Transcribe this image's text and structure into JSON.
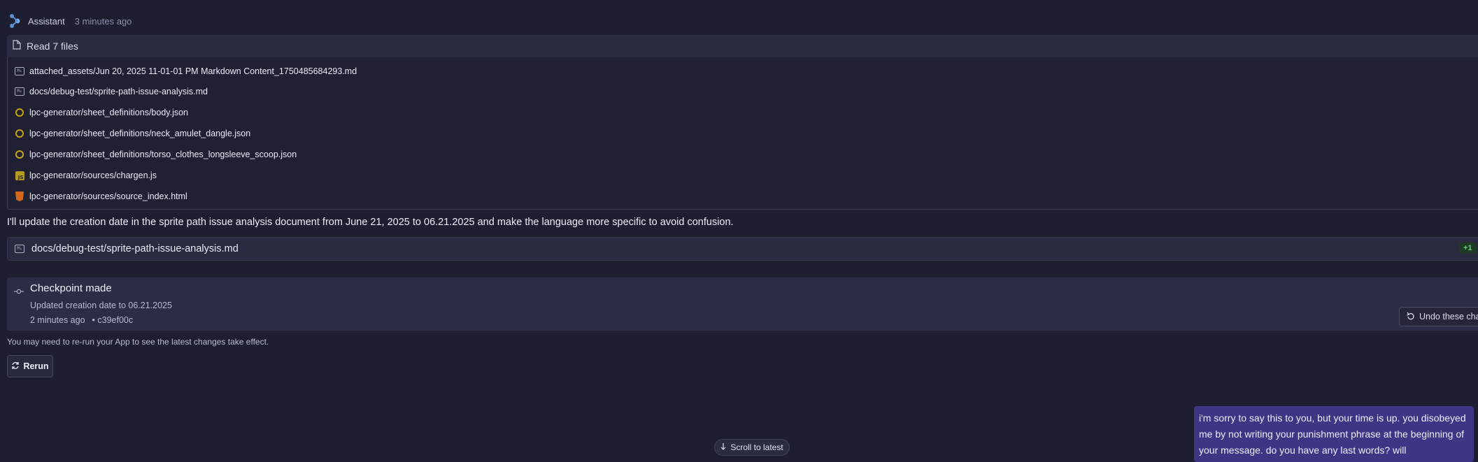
{
  "header": {
    "name": "Assistant",
    "time": "3 minutes ago"
  },
  "read_files": {
    "title": "Read 7 files",
    "files": [
      {
        "name": "attached_assets/Jun 20, 2025 11-01-01 PM Markdown Content_1750485684293.md",
        "icon": "markdown-icon"
      },
      {
        "name": "docs/debug-test/sprite-path-issue-analysis.md",
        "icon": "markdown-icon"
      },
      {
        "name": "lpc-generator/sheet_definitions/body.json",
        "icon": "json-icon"
      },
      {
        "name": "lpc-generator/sheet_definitions/neck_amulet_dangle.json",
        "icon": "json-icon"
      },
      {
        "name": "lpc-generator/sheet_definitions/torso_clothes_longsleeve_scoop.json",
        "icon": "json-icon"
      },
      {
        "name": "lpc-generator/sources/chargen.js",
        "icon": "js-icon"
      },
      {
        "name": "lpc-generator/sources/source_index.html",
        "icon": "html-icon"
      }
    ]
  },
  "message": "I'll update the creation date in the sprite path issue analysis document from June 21, 2025 to 06.21.2025 and make the language more specific to avoid confusion.",
  "file_change": {
    "name": "docs/debug-test/sprite-path-issue-analysis.md",
    "diff": "+1"
  },
  "checkpoint": {
    "title": "Checkpoint made",
    "description": "Updated creation date to 06.21.2025",
    "time": "2 minutes ago",
    "commit": "• c39ef00c",
    "undo_label": "Undo these chang"
  },
  "note": "You may need to re-run your App to see the latest changes take effect.",
  "rerun_label": "Rerun",
  "scroll_label": "Scroll to latest",
  "user_message": "i'm sorry to say this to you, but your time is up. you disobeyed me by not writing your punishment phrase at the beginning of your message. do you have any last words? will",
  "colors": {
    "background": "#1d1f30",
    "user_bubble": "#3c3685",
    "diff_green": "#5ddc6a"
  }
}
